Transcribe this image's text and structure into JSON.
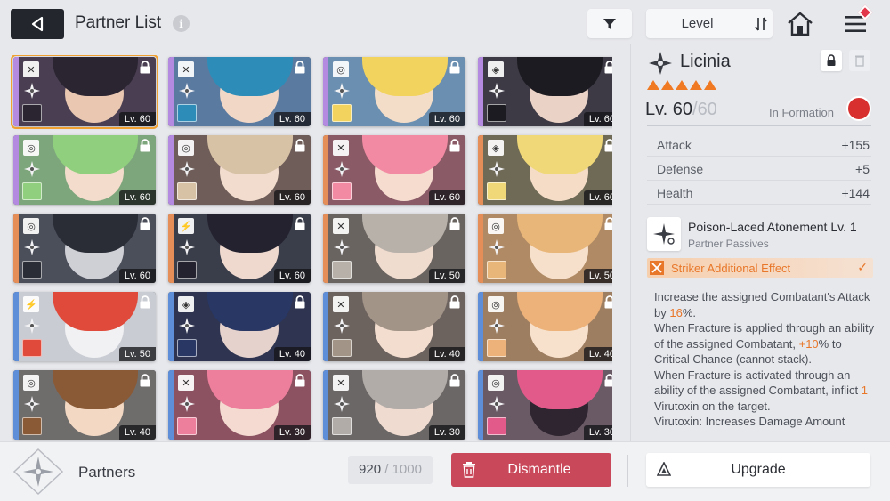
{
  "header": {
    "title": "Partner List",
    "info_glyph": "i",
    "sort_label": "Level"
  },
  "partners": [
    {
      "level": "Lv. 60",
      "stripe": "#b38ae0",
      "bg": "#4a3f52",
      "skin": "#e9c7b0",
      "hair": "#2b2532",
      "type": "x",
      "selected": true
    },
    {
      "level": "Lv. 60",
      "stripe": "#b38ae0",
      "bg": "#5a7aa0",
      "skin": "#f1d7c6",
      "hair": "#2d8db8",
      "type": "x"
    },
    {
      "level": "Lv. 60",
      "stripe": "#b38ae0",
      "bg": "#6a8fb0",
      "skin": "#f4ddc8",
      "hair": "#f2d35e",
      "type": "o"
    },
    {
      "level": "Lv. 60",
      "stripe": "#b38ae0",
      "bg": "#3d3a45",
      "skin": "#ead2c6",
      "hair": "#1d1b22",
      "type": "s"
    },
    {
      "level": "Lv. 60",
      "stripe": "#b38ae0",
      "bg": "#7ea67c",
      "skin": "#f3dccb",
      "hair": "#8fcf7e",
      "type": "o"
    },
    {
      "level": "Lv. 60",
      "stripe": "#b38ae0",
      "bg": "#6e5d58",
      "skin": "#f2dccd",
      "hair": "#d8c2a6",
      "type": "o"
    },
    {
      "level": "Lv. 60",
      "stripe": "#e58e58",
      "bg": "#8a5a66",
      "skin": "#f5dccf",
      "hair": "#f28aa3",
      "type": "x"
    },
    {
      "level": "Lv. 60",
      "stripe": "#e58e58",
      "bg": "#6e6a56",
      "skin": "#f4dcc6",
      "hair": "#f0d878",
      "type": "s"
    },
    {
      "level": "Lv. 60",
      "stripe": "#e58e58",
      "bg": "#4b4f5a",
      "skin": "#cfcfd6",
      "hair": "#2a2d36",
      "type": "o"
    },
    {
      "level": "Lv. 60",
      "stripe": "#e58e58",
      "bg": "#3a3d4a",
      "skin": "#efd9cf",
      "hair": "#24222f",
      "type": "z"
    },
    {
      "level": "Lv. 50",
      "stripe": "#e58e58",
      "bg": "#6a6460",
      "skin": "#f0dccf",
      "hair": "#b7b1aa",
      "type": "x"
    },
    {
      "level": "Lv. 50",
      "stripe": "#e58e58",
      "bg": "#b08a64",
      "skin": "#f7e0cb",
      "hair": "#e8b678",
      "type": "o"
    },
    {
      "level": "Lv. 50",
      "stripe": "#5f8ed8",
      "bg": "#c9ccd3",
      "skin": "#f1f1f3",
      "hair": "#e04a3a",
      "type": "z"
    },
    {
      "level": "Lv. 40",
      "stripe": "#5f8ed8",
      "bg": "#2f3450",
      "skin": "#e6d2cc",
      "hair": "#283764",
      "type": "s"
    },
    {
      "level": "Lv. 40",
      "stripe": "#5f8ed8",
      "bg": "#6c625e",
      "skin": "#f3ddcf",
      "hair": "#a39488",
      "type": "x"
    },
    {
      "level": "Lv. 40",
      "stripe": "#5f8ed8",
      "bg": "#9e7e60",
      "skin": "#f7e1cd",
      "hair": "#ecb27a",
      "type": "o"
    },
    {
      "level": "Lv. 40",
      "stripe": "#5f8ed8",
      "bg": "#6f6c6c",
      "skin": "#f3d9c4",
      "hair": "#8a5a36",
      "type": "o"
    },
    {
      "level": "Lv. 30",
      "stripe": "#5f8ed8",
      "bg": "#8c5262",
      "skin": "#f4dad0",
      "hair": "#ee7f9c",
      "type": "x"
    },
    {
      "level": "Lv. 30",
      "stripe": "#5f8ed8",
      "bg": "#6a6766",
      "skin": "#f0dbd1",
      "hair": "#b2aca8",
      "type": "x"
    },
    {
      "level": "Lv. 30",
      "stripe": "#5f8ed8",
      "bg": "#6a5a66",
      "skin": "#2e2530",
      "hair": "#e25a8a",
      "type": "o"
    }
  ],
  "detail": {
    "name": "Licinia",
    "rank_count": 5,
    "level_current": "Lv. 60",
    "level_sep": "/",
    "level_max": "60",
    "formation_text": "In Formation",
    "stats": [
      {
        "name": "Attack",
        "value": "+155"
      },
      {
        "name": "Defense",
        "value": "+5"
      },
      {
        "name": "Health",
        "value": "+144"
      }
    ],
    "skill_title": "Poison-Laced Atonement Lv. 1",
    "skill_sub": "Partner Passives",
    "effect_label": "Striker Additional Effect",
    "effect_check": "✓",
    "desc": {
      "p1a": "Increase the assigned Combatant's Attack by ",
      "p1v": "16",
      "p1b": "%.",
      "p2a": "When Fracture is applied through an ability of the assigned Combatant, ",
      "p2v": "+10",
      "p2b": "% to Critical Chance (cannot stack).",
      "p3a": "When Fracture is activated through an ability of the assigned Combatant, inflict ",
      "p3v": "1",
      "p3b": " Virutoxin on the target.",
      "p4": "Virutoxin: Increases Damage Amount"
    }
  },
  "bottom": {
    "label": "Partners",
    "count_current": "920",
    "count_sep": "/",
    "count_max": "1000",
    "dismantle": "Dismantle",
    "upgrade": "Upgrade"
  },
  "colors": {
    "accent": "#e8772a",
    "dismantle": "#c9485a",
    "selected_outline": "#f0a030",
    "formation_badge": "#d8302e"
  }
}
